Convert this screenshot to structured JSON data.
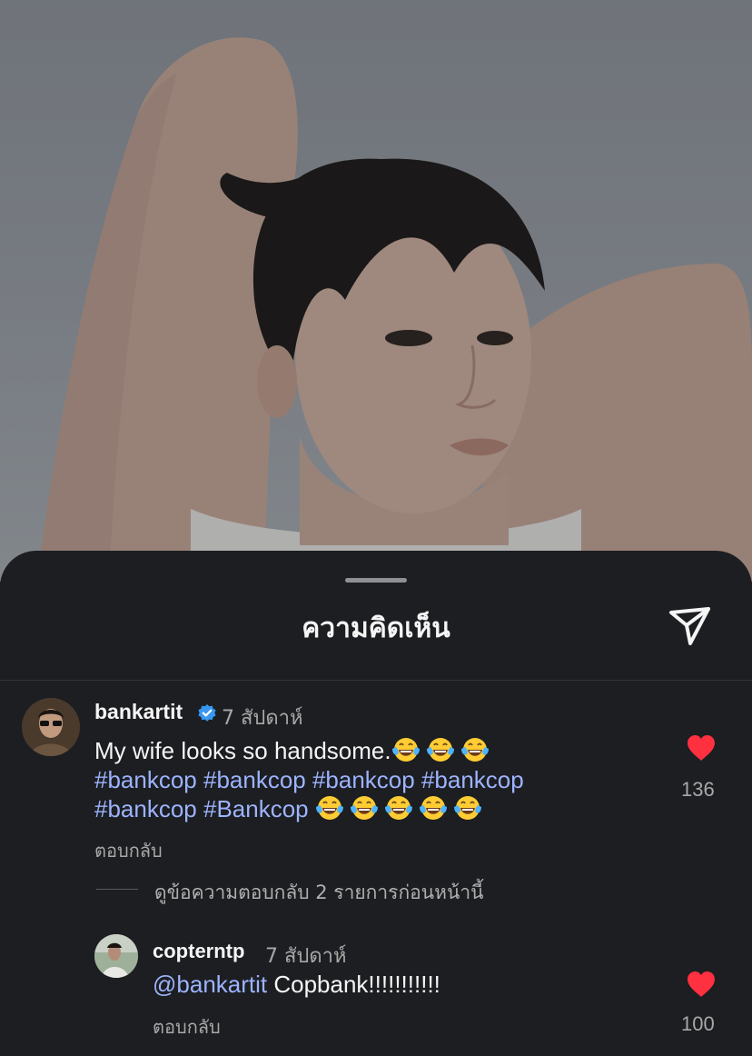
{
  "sheet": {
    "title": "ความคิดเห็น"
  },
  "comments": [
    {
      "username": "bankartit",
      "verified": true,
      "time": "7 สัปดาห์",
      "text_main": "My wife looks so handsome.",
      "emoji_after_main": 3,
      "hashtags_line1": "#bankcop #bankcop #bankcop #bankcop",
      "hashtags_line2": "#bankcop #Bankcop",
      "emoji_after_tags": 5,
      "reply_label": "ตอบกลับ",
      "likes": "136"
    }
  ],
  "view_replies": "ดูข้อความตอบกลับ 2 รายการก่อนหน้านี้",
  "reply": {
    "username": "copterntp",
    "time": "7 สัปดาห์",
    "mention": "@bankartit",
    "text": "Copbank!!!!!!!!!!!",
    "reply_label": "ตอบกลับ",
    "likes": "100"
  },
  "icons": {
    "share": "paper-plane-icon",
    "like": "heart-icon",
    "verified": "verified-badge-icon",
    "emoji": "tears-of-joy-emoji"
  },
  "colors": {
    "sheet_bg": "#1c1e21",
    "heart": "#ff3040",
    "hashtag": "#9db3ff",
    "verified": "#3897f0"
  }
}
